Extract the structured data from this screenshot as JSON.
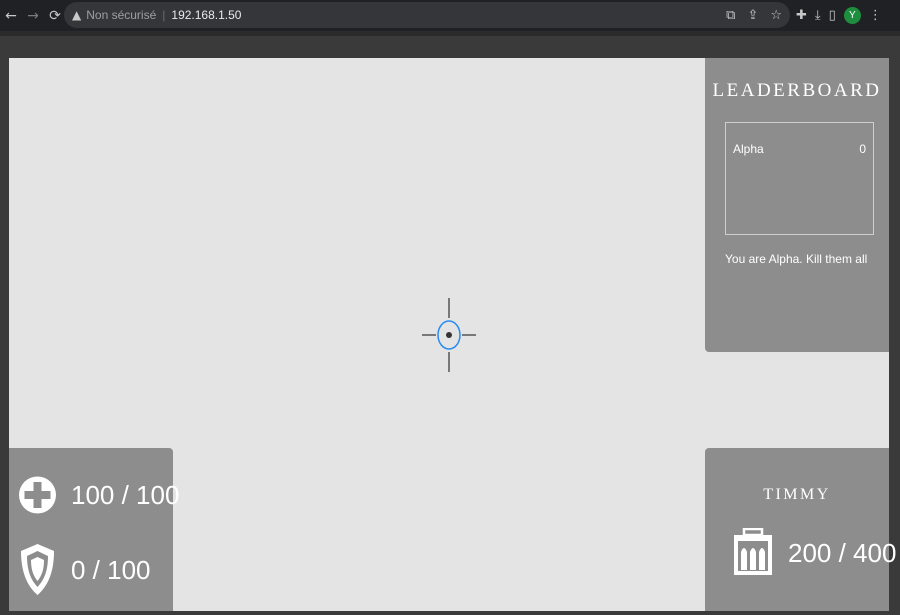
{
  "browser": {
    "security_label": "Non sécurisé",
    "separator": "|",
    "url": "192.168.1.50",
    "profile_initial": "Y"
  },
  "leaderboard": {
    "title": "LEADERBOARD",
    "entries": [
      {
        "name": "Alpha",
        "score": "0"
      }
    ],
    "message": "You are Alpha. Kill them all"
  },
  "player": {
    "health": "100 / 100",
    "health_current": 100,
    "health_max": 100,
    "shield": "0 / 100",
    "shield_current": 0,
    "shield_max": 100
  },
  "weapon": {
    "name": "TIMMY",
    "ammo": "200 / 400",
    "ammo_current": 200,
    "ammo_max": 400
  },
  "colors": {
    "game_background": "#e4e4e4",
    "panel": "#8d8d8d",
    "crosshair_ring": "#2a8cf0",
    "crosshair_lines": "#555555"
  }
}
